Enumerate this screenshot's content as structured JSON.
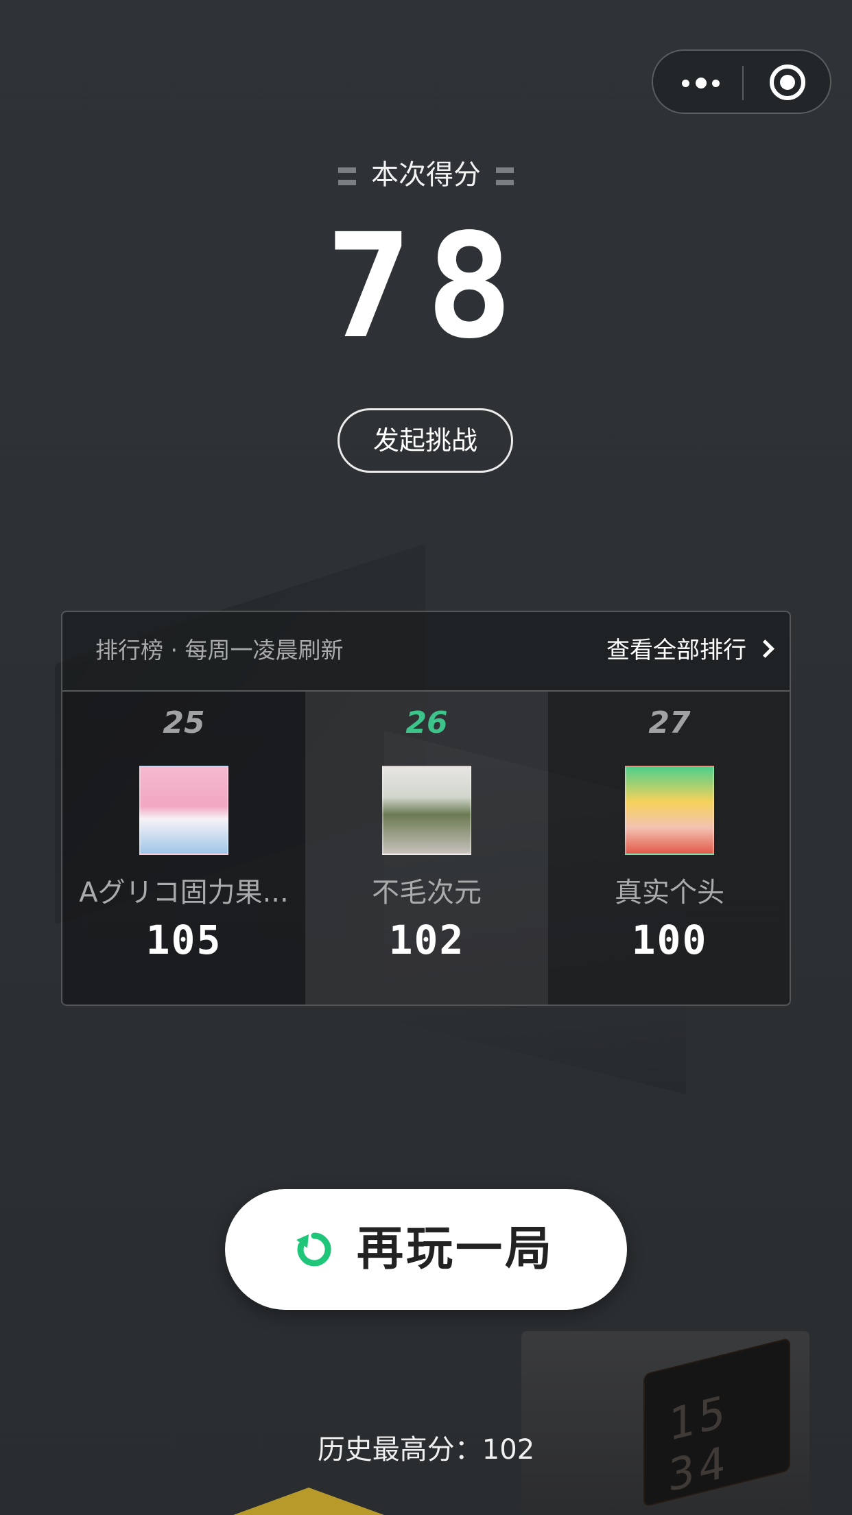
{
  "capsule": {
    "more_icon": "more-dots-icon",
    "close_icon": "target-circle-icon"
  },
  "score": {
    "title": "本次得分",
    "value": "78"
  },
  "challenge": {
    "label": "发起挑战"
  },
  "leaderboard": {
    "title": "排行榜 · 每周一凌晨刷新",
    "view_all": "查看全部排行",
    "entries": [
      {
        "rank": "25",
        "name": "Aグリコ固力果...",
        "score": "105"
      },
      {
        "rank": "26",
        "name": "不毛次元",
        "score": "102"
      },
      {
        "rank": "27",
        "name": "真实个头",
        "score": "100"
      }
    ]
  },
  "replay": {
    "label": "再玩一局",
    "icon": "replay-icon",
    "accent": "#1fc679"
  },
  "history": {
    "text": "历史最高分：102"
  },
  "background": {
    "clock_digits": "15 34"
  }
}
